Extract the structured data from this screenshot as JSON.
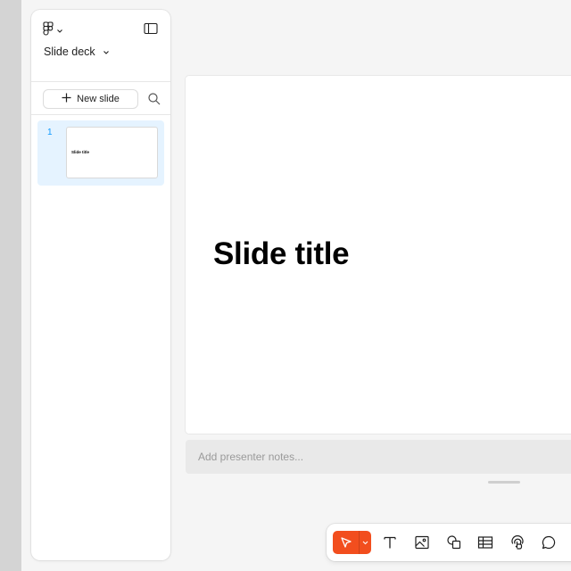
{
  "sidebar": {
    "deck_name": "Slide deck",
    "new_slide_label": "New slide",
    "slides": [
      {
        "number": "1",
        "title": "Slide title",
        "selected": true
      }
    ]
  },
  "canvas": {
    "slide_title": "Slide title",
    "notes_placeholder": "Add presenter notes..."
  },
  "toolbar": {
    "tools": [
      "move",
      "text",
      "image",
      "shapes",
      "table",
      "interaction",
      "comment"
    ]
  },
  "colors": {
    "accent": "#f24e1e",
    "selection": "#e5f3ff",
    "slide_number": "#0d99ff"
  }
}
